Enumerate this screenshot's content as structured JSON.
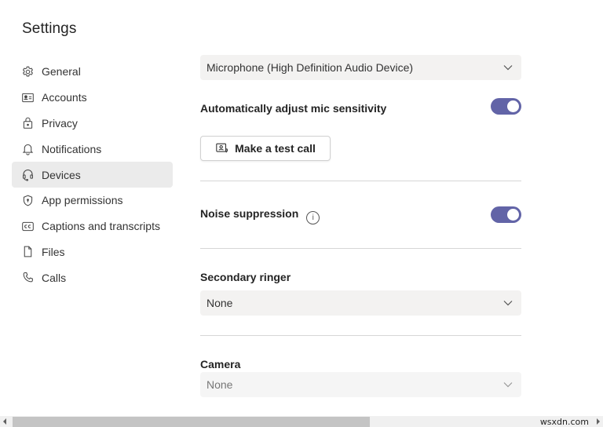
{
  "window": {
    "title": "Settings"
  },
  "sidebar": {
    "items": [
      {
        "label": "General",
        "icon": "gear-icon",
        "active": false
      },
      {
        "label": "Accounts",
        "icon": "id-card-icon",
        "active": false
      },
      {
        "label": "Privacy",
        "icon": "lock-icon",
        "active": false
      },
      {
        "label": "Notifications",
        "icon": "bell-icon",
        "active": false
      },
      {
        "label": "Devices",
        "icon": "headset-icon",
        "active": true
      },
      {
        "label": "App permissions",
        "icon": "shield-icon",
        "active": false
      },
      {
        "label": "Captions and transcripts",
        "icon": "cc-icon",
        "active": false
      },
      {
        "label": "Files",
        "icon": "file-icon",
        "active": false
      },
      {
        "label": "Calls",
        "icon": "phone-icon",
        "active": false
      }
    ]
  },
  "devices": {
    "microphone": {
      "value": "Microphone (High Definition Audio Device)"
    },
    "auto_mic": {
      "label": "Automatically adjust mic sensitivity",
      "on": true
    },
    "test_call": {
      "label": "Make a test call"
    },
    "noise_suppression": {
      "label": "Noise suppression",
      "info_glyph": "i",
      "on": true
    },
    "secondary_ringer": {
      "label": "Secondary ringer",
      "value": "None"
    },
    "camera": {
      "label": "Camera",
      "value": "None"
    }
  },
  "accent_color": "#6264a7",
  "watermark": "wsxdn.com"
}
